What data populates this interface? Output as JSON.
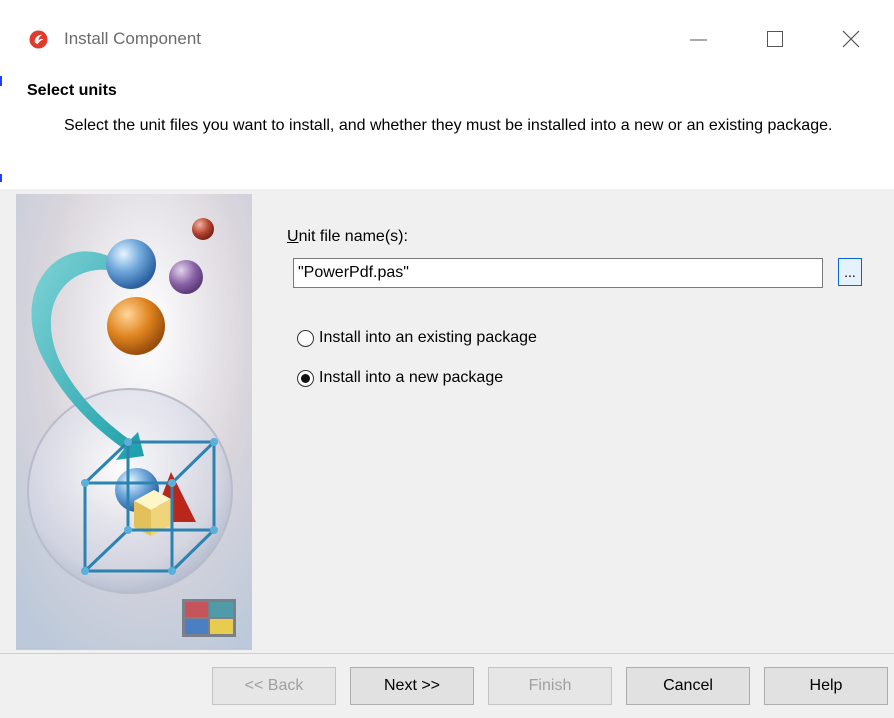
{
  "window": {
    "title": "Install Component",
    "controls": {
      "minimize": "minimize-icon",
      "maximize": "maximize-icon",
      "close": "close-icon"
    }
  },
  "header": {
    "title": "Select units",
    "description": "Select the unit files you want to install, and whether they must be installed into a new or an existing package."
  },
  "form": {
    "unit_label_accel": "U",
    "unit_label_rest": "nit file name(s):",
    "unit_value": "\"PowerPdf.pas\"",
    "browse_label": "...",
    "options": [
      {
        "label": "Install into an existing package",
        "checked": false
      },
      {
        "label": "Install into a new package",
        "checked": true
      }
    ]
  },
  "footer": {
    "back": "<< Back",
    "next": "Next >>",
    "finish": "Finish",
    "cancel": "Cancel",
    "help": "Help"
  },
  "colors": {
    "accent": "#0a64d8",
    "panel": "#f0f0f0"
  }
}
